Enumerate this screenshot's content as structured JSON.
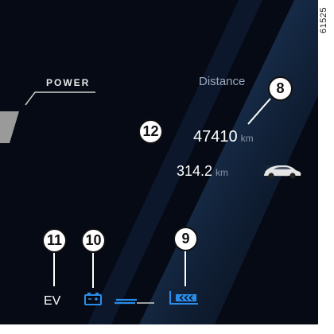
{
  "reference_code": "61525",
  "power": {
    "label": "POWER"
  },
  "distance": {
    "title": "Distance",
    "odometer_value": "47410",
    "odometer_unit": "km",
    "trip_value": "314.2",
    "trip_unit": "km"
  },
  "status_row": {
    "drive_mode": "EV"
  },
  "callouts": {
    "distance": "8",
    "regen": "9",
    "battery": "10",
    "drive_mode": "11",
    "center": "12"
  },
  "colors": {
    "accent_blue": "#2a8ce8",
    "background": "#050a14",
    "text_secondary": "#9aa8bd"
  },
  "icons": [
    "battery-icon",
    "regen-braking-icon",
    "car-icon"
  ]
}
